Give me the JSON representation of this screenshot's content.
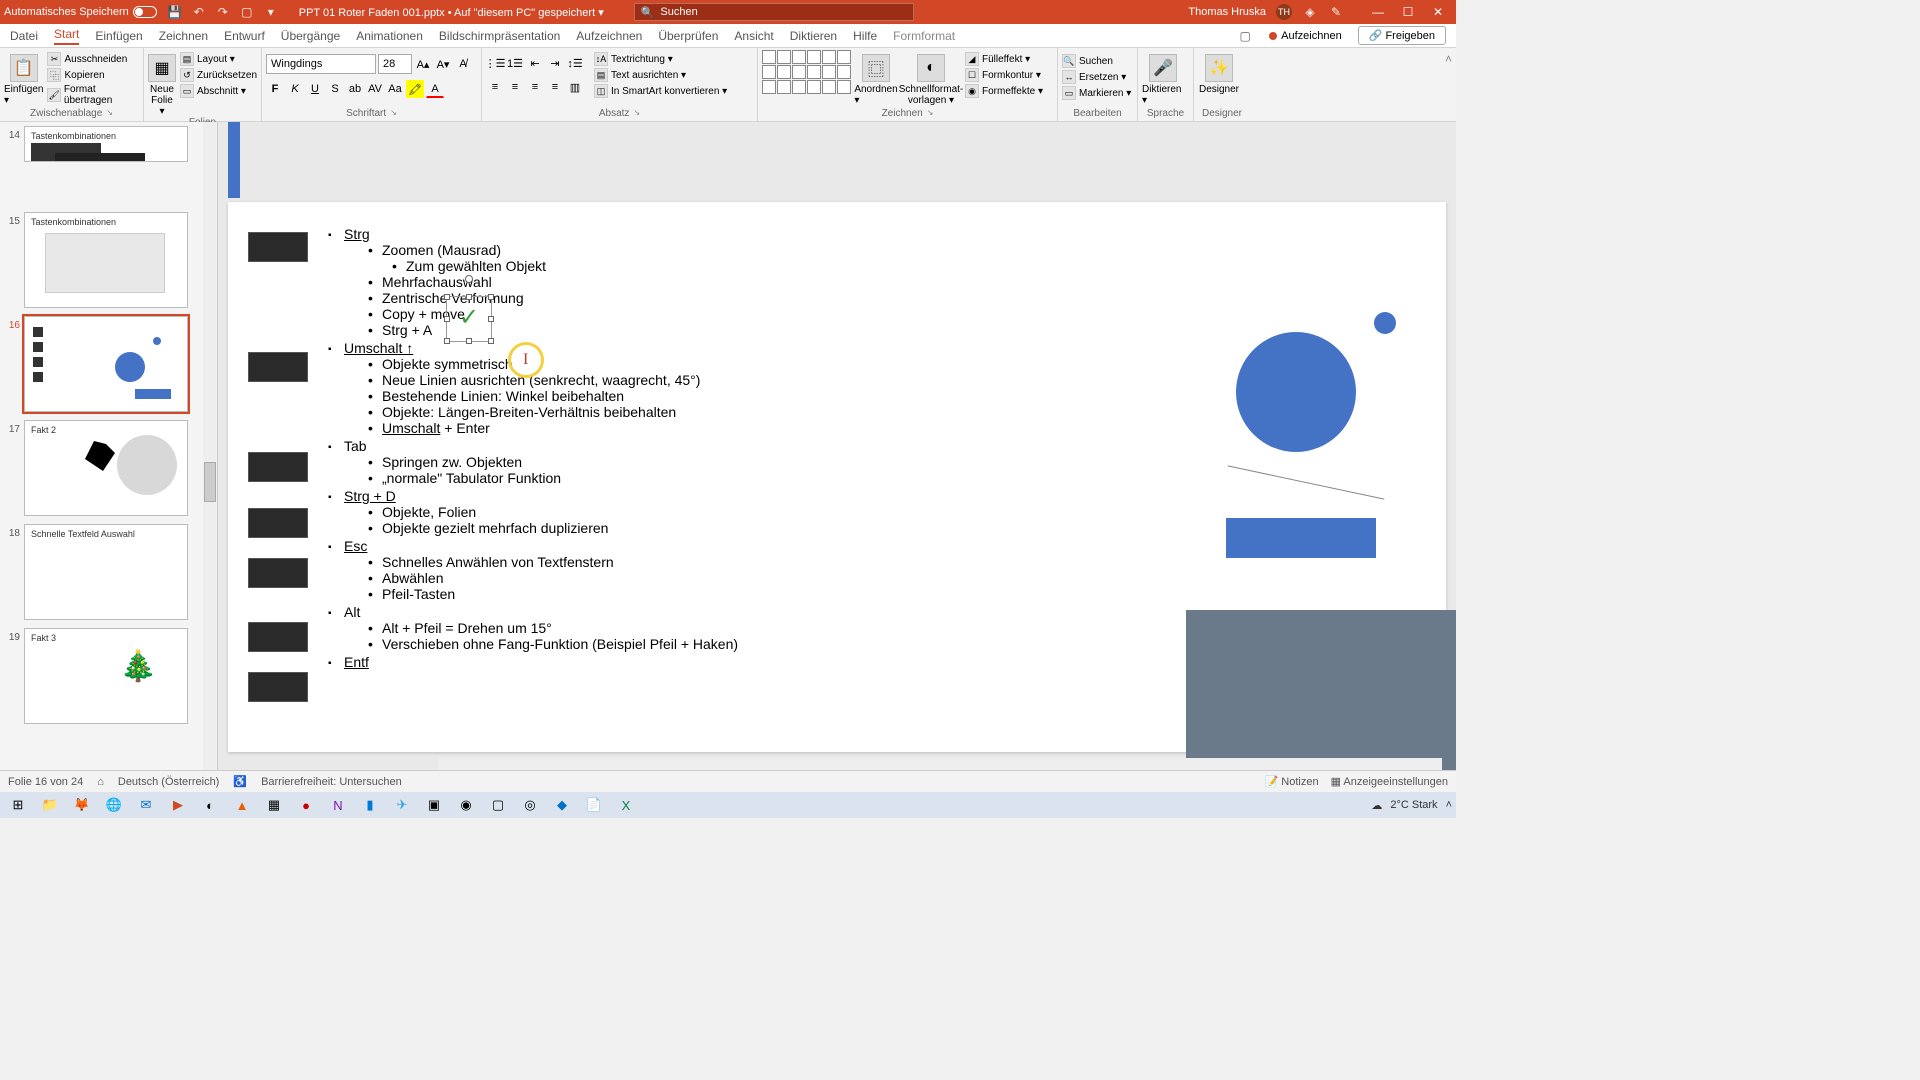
{
  "titlebar": {
    "autosave": "Automatisches Speichern",
    "filename": "PPT 01 Roter Faden 001.pptx • Auf \"diesem PC\" gespeichert ▾",
    "search_placeholder": "Suchen",
    "user": "Thomas Hruska",
    "initials": "TH"
  },
  "tabs": [
    "Datei",
    "Start",
    "Einfügen",
    "Zeichnen",
    "Entwurf",
    "Übergänge",
    "Animationen",
    "Bildschirmpräsentation",
    "Aufzeichnen",
    "Überprüfen",
    "Ansicht",
    "Diktieren",
    "Hilfe",
    "Formformat"
  ],
  "tabs_right": {
    "record": "Aufzeichnen",
    "share": "Freigeben"
  },
  "ribbon": {
    "clipboard": {
      "label": "Zwischenablage",
      "paste": "Einfügen ▾",
      "cut": "Ausschneiden",
      "copy": "Kopieren",
      "format": "Format übertragen"
    },
    "slides": {
      "label": "Folien",
      "new": "Neue\nFolie ▾",
      "layout": "Layout ▾",
      "reset": "Zurücksetzen",
      "section": "Abschnitt ▾"
    },
    "font": {
      "label": "Schriftart",
      "name": "Wingdings",
      "size": "28"
    },
    "para": {
      "label": "Absatz",
      "textdir": "Textrichtung ▾",
      "align": "Text ausrichten ▾",
      "smart": "In SmartArt konvertieren ▾"
    },
    "draw": {
      "label": "Zeichnen",
      "arrange": "Anordnen ▾",
      "quick": "Schnellformat-\nvorlagen ▾",
      "fill": "Fülleffekt ▾",
      "outline": "Formkontur ▾",
      "effects": "Formeffekte ▾"
    },
    "edit": {
      "label": "Bearbeiten",
      "find": "Suchen",
      "replace": "Ersetzen ▾",
      "select": "Markieren ▾"
    },
    "voice": {
      "label": "Sprache",
      "dictate": "Diktieren ▾"
    },
    "designer": {
      "label": "Designer",
      "btn": "Designer"
    }
  },
  "thumbs": [
    {
      "n": "14",
      "title": "Tastenkombinationen"
    },
    {
      "n": "15",
      "title": "Tastenkombinationen"
    },
    {
      "n": "16",
      "title": "",
      "selected": true
    },
    {
      "n": "17",
      "title": "Fakt 2"
    },
    {
      "n": "18",
      "title": "Schnelle Textfeld Auswahl"
    },
    {
      "n": "19",
      "title": "Fakt 3"
    }
  ],
  "content": {
    "strg": {
      "h": "Strg",
      "items": [
        "Zoomen (Mausrad)",
        "Mehrfachauswahl",
        "Zentrische Verformung",
        "Copy + move",
        "Strg + A"
      ],
      "sub": "Zum gewählten Objekt"
    },
    "umschalt": {
      "h": "Umschalt ↑",
      "items": [
        "Objekte symmetrisch",
        "Neue Linien ausrichten (senkrecht, waagrecht, 45°)",
        "Bestehende Linien: Winkel beibehalten",
        "Objekte: Längen-Breiten-Verhältnis beibehalten",
        "Umschalt + Enter"
      ]
    },
    "tab": {
      "h": "Tab",
      "items": [
        "Springen zw. Objekten",
        "„normale\" Tabulator Funktion"
      ]
    },
    "strgd": {
      "h": "Strg + D",
      "items": [
        "Objekte, Folien",
        "Objekte gezielt mehrfach duplizieren"
      ]
    },
    "esc": {
      "h": "Esc",
      "items": [
        "Schnelles Anwählen von Textfenstern",
        "Abwählen",
        "Pfeil-Tasten"
      ]
    },
    "alt": {
      "h": "Alt",
      "items": [
        "Alt + Pfeil = Drehen um 15°",
        "Verschieben ohne Fang-Funktion (Beispiel Pfeil + Haken)"
      ]
    },
    "entf": {
      "h": "Entf"
    }
  },
  "status": {
    "slide": "Folie 16 von 24",
    "lang": "Deutsch (Österreich)",
    "access": "Barrierefreiheit: Untersuchen",
    "notes": "Notizen",
    "display": "Anzeigeeinstellungen"
  },
  "taskbar": {
    "weather": "2°C  Stark"
  }
}
